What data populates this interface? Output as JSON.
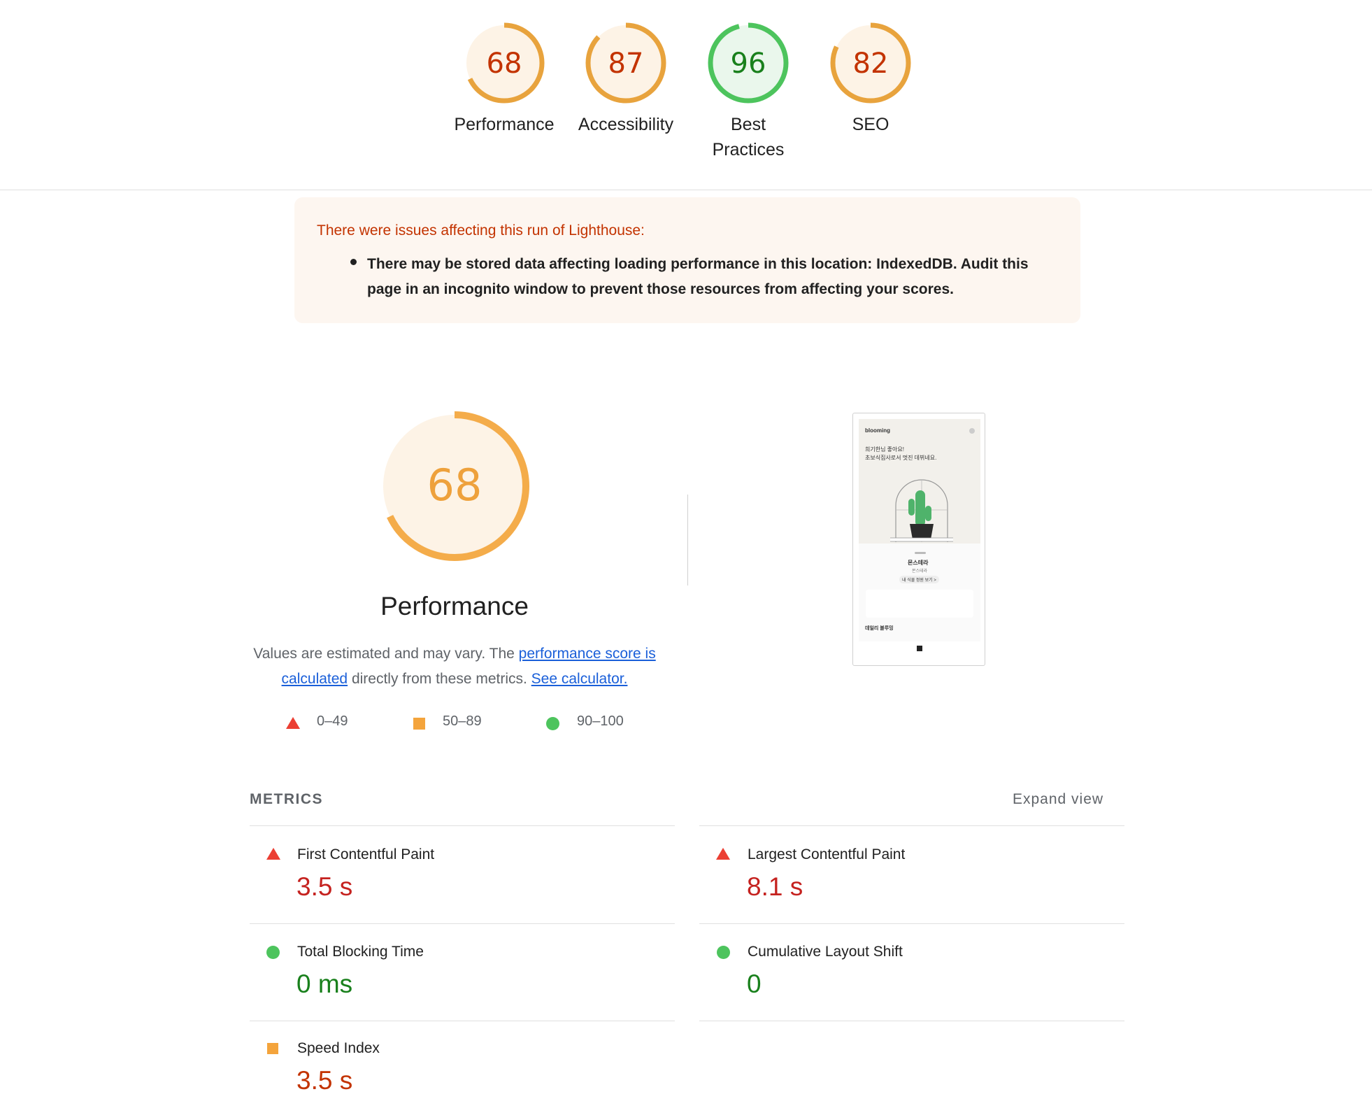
{
  "categories": [
    {
      "score": "68",
      "label": "Performance",
      "fraction": 0.68,
      "color": "#e8a33d",
      "text_color": "#c33300",
      "fill": "#fdf3e6"
    },
    {
      "score": "87",
      "label": "Accessibility",
      "fraction": 0.87,
      "color": "#e8a33d",
      "text_color": "#c33300",
      "fill": "#fdf3e6"
    },
    {
      "score": "96",
      "label": "Best Practices",
      "fraction": 0.96,
      "color": "#4dc45d",
      "text_color": "#19801c",
      "fill": "#eaf7ec"
    },
    {
      "score": "82",
      "label": "SEO",
      "fraction": 0.82,
      "color": "#e8a33d",
      "text_color": "#c33300",
      "fill": "#fdf3e6"
    }
  ],
  "warning": {
    "title": "There were issues affecting this run of Lighthouse:",
    "item": "There may be stored data affecting loading performance in this location: IndexedDB. Audit this page in an incognito window to prevent those resources from affecting your scores."
  },
  "performance": {
    "score": "68",
    "fraction": 0.68,
    "title": "Performance",
    "desc_prefix": "Values are estimated and may vary. The ",
    "link_score": "performance score is calculated",
    "desc_middle": " directly from these metrics. ",
    "link_calc": "See calculator."
  },
  "legend": {
    "fail": "0–49",
    "average": "50–89",
    "pass": "90–100"
  },
  "thumbnail": {
    "brand": "blooming",
    "greeting_1": "희기한님 좋아요!",
    "greeting_2": "초보식집사로서 멋진 데뷔네요.",
    "plant_name": "몬스테라",
    "plant_sub": "몬스테라",
    "cta": "내 식물 정원 보기 >",
    "section": "데일리 블루밍"
  },
  "metrics": {
    "title": "METRICS",
    "expand": "Expand view",
    "items": [
      {
        "label": "First Contentful Paint",
        "value": "3.5 s",
        "status": "fail"
      },
      {
        "label": "Largest Contentful Paint",
        "value": "8.1 s",
        "status": "fail"
      },
      {
        "label": "Total Blocking Time",
        "value": "0 ms",
        "status": "pass"
      },
      {
        "label": "Cumulative Layout Shift",
        "value": "0",
        "status": "pass"
      },
      {
        "label": "Speed Index",
        "value": "3.5 s",
        "status": "average"
      }
    ]
  },
  "colors": {
    "fail": "#eb3f33",
    "average": "#f4a43c",
    "pass": "#4dc45d",
    "fail_text": "#c5221f",
    "average_text": "#c33300",
    "pass_text": "#19801c"
  }
}
